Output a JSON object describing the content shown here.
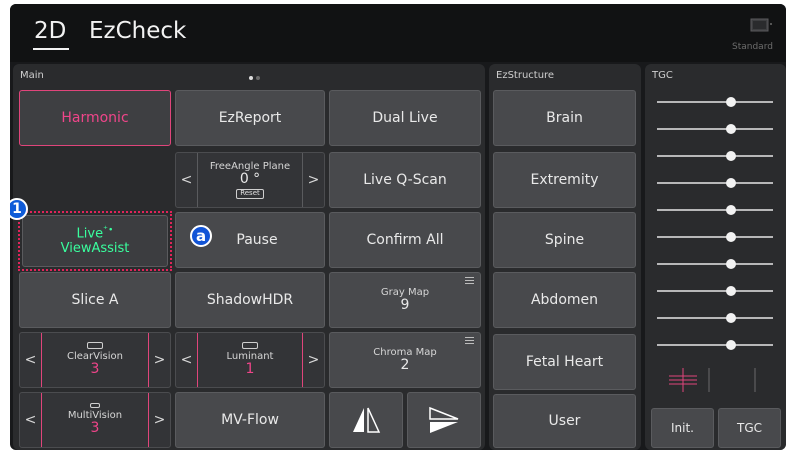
{
  "header": {
    "tab_2d": "2D",
    "tab_ezcheck": "EzCheck",
    "standard": "Standard",
    "monitor_icon": "monitor-icon"
  },
  "main": {
    "title": "Main",
    "harmonic": "Harmonic",
    "ezreport": "EzReport",
    "dual_live": "Dual Live",
    "freeangle_label": "FreeAngle Plane",
    "freeangle_value": "0 °",
    "freeangle_reset": "Reset",
    "live_qscan": "Live Q-Scan",
    "viewassist_line1": "Live",
    "viewassist_line2": "ViewAssist",
    "pause": "Pause",
    "confirm_all": "Confirm All",
    "slice_a": "Slice A",
    "shadowhdr": "ShadowHDR",
    "graymap_label": "Gray Map",
    "graymap_value": "9",
    "clearvision_label": "ClearVision",
    "clearvision_value": "3",
    "luminant_label": "Luminant",
    "luminant_value": "1",
    "chromamap_label": "Chroma Map",
    "chromamap_value": "2",
    "multivision_label": "MultiVision",
    "multivision_value": "3",
    "mvflow": "MV-Flow",
    "prev_arrow": "<",
    "next_arrow": ">"
  },
  "ezstructure": {
    "title": "EzStructure",
    "items": [
      "Brain",
      "Extremity",
      "Spine",
      "Abdomen",
      "Fetal Heart",
      "User"
    ]
  },
  "tgc": {
    "title": "TGC",
    "init": "Init.",
    "tgc_button": "TGC",
    "slider_count_positions": [
      0.5,
      0.5,
      0.5,
      0.5,
      0.5,
      0.5,
      0.5,
      0.5,
      0.5,
      0.5
    ]
  },
  "callouts": {
    "one": "1",
    "a": "a"
  },
  "colors": {
    "accent_pink": "#f0458a",
    "accent_green": "#39ff9e",
    "callout_blue": "#1254d6",
    "dotted_outline": "#e0245a"
  }
}
